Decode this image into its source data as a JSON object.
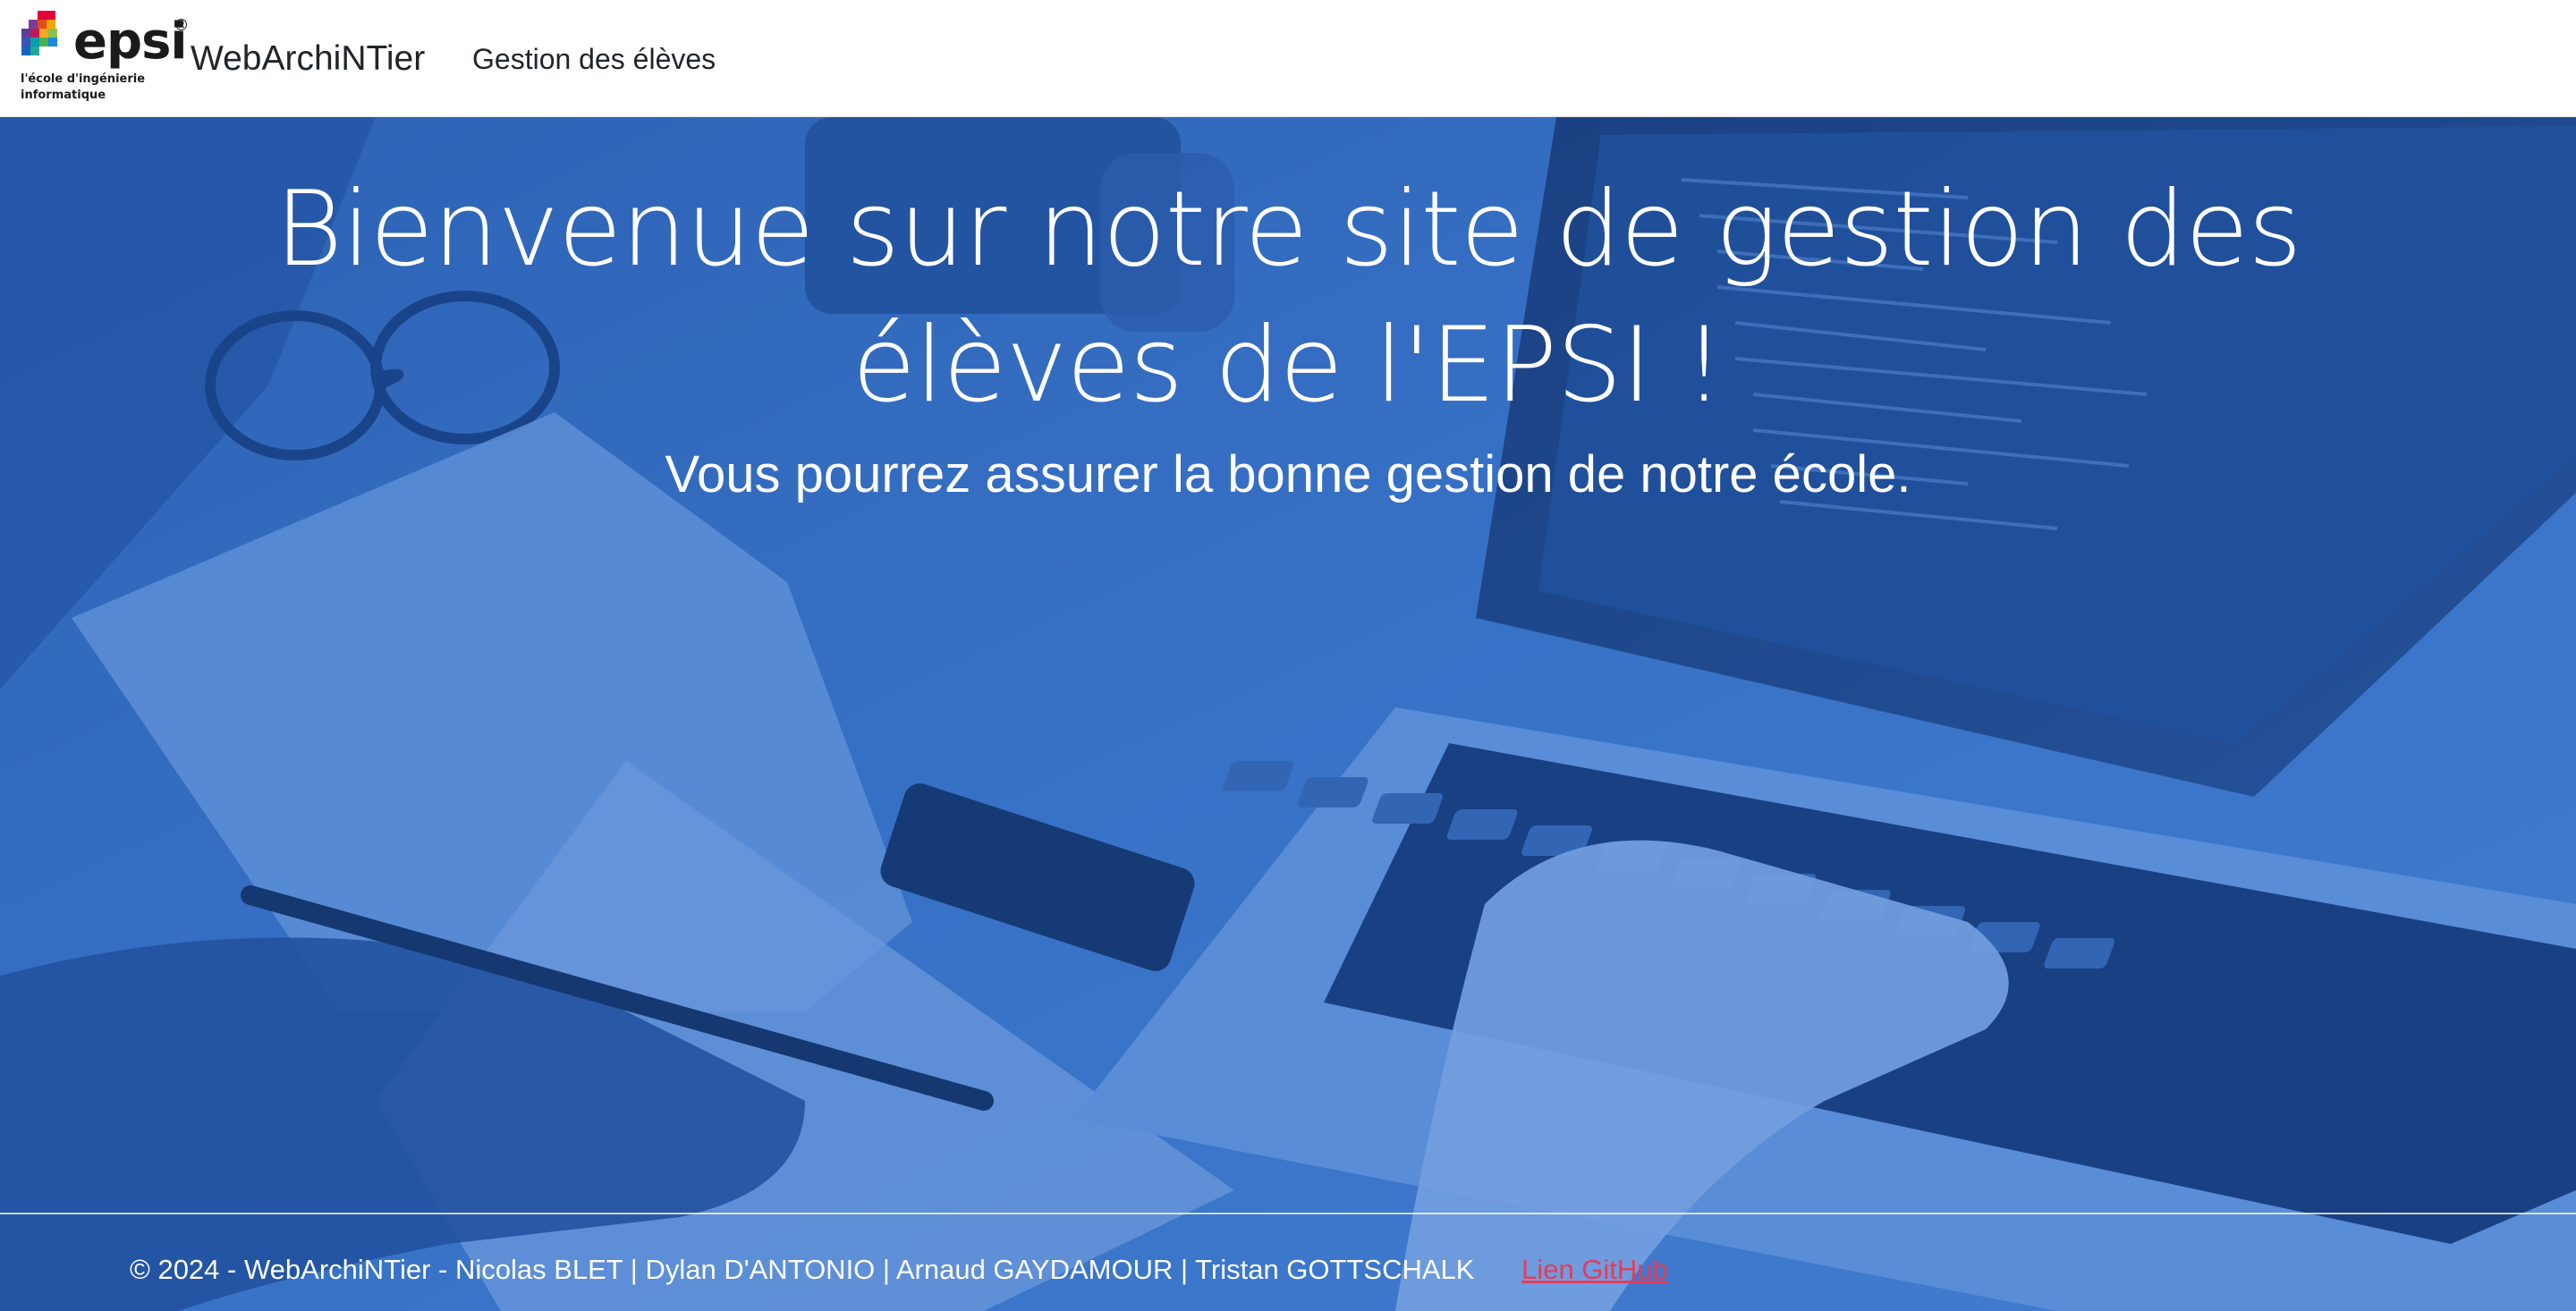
{
  "logo": {
    "wordmark": "epsi",
    "registered": "®",
    "tagline_line1": "l'école d'ingénierie",
    "tagline_line2": "informatique"
  },
  "navbar": {
    "brand": "WebArchiNTier",
    "links": [
      {
        "label": "Gestion des élèves"
      }
    ]
  },
  "hero": {
    "title": "Bienvenue sur notre site de gestion des élèves de l'EPSI !",
    "subtitle": "Vous pourrez assurer la bonne gestion de notre école."
  },
  "footer": {
    "copyright": "© 2024 - WebArchiNTier - Nicolas BLET | Dylan D'ANTONIO | Arnaud GAYDAMOUR | Tristan GOTTSCHALK",
    "link_label": "Lien GitHub"
  },
  "colors": {
    "overlay": "#3a74c8",
    "footer_link": "#e63b5a",
    "navbar_bg": "#ffffff",
    "text_dark": "#212529"
  },
  "icons": {
    "logo_mark": "epsi-pixel-logo",
    "background": "laptop-typing-photo"
  }
}
